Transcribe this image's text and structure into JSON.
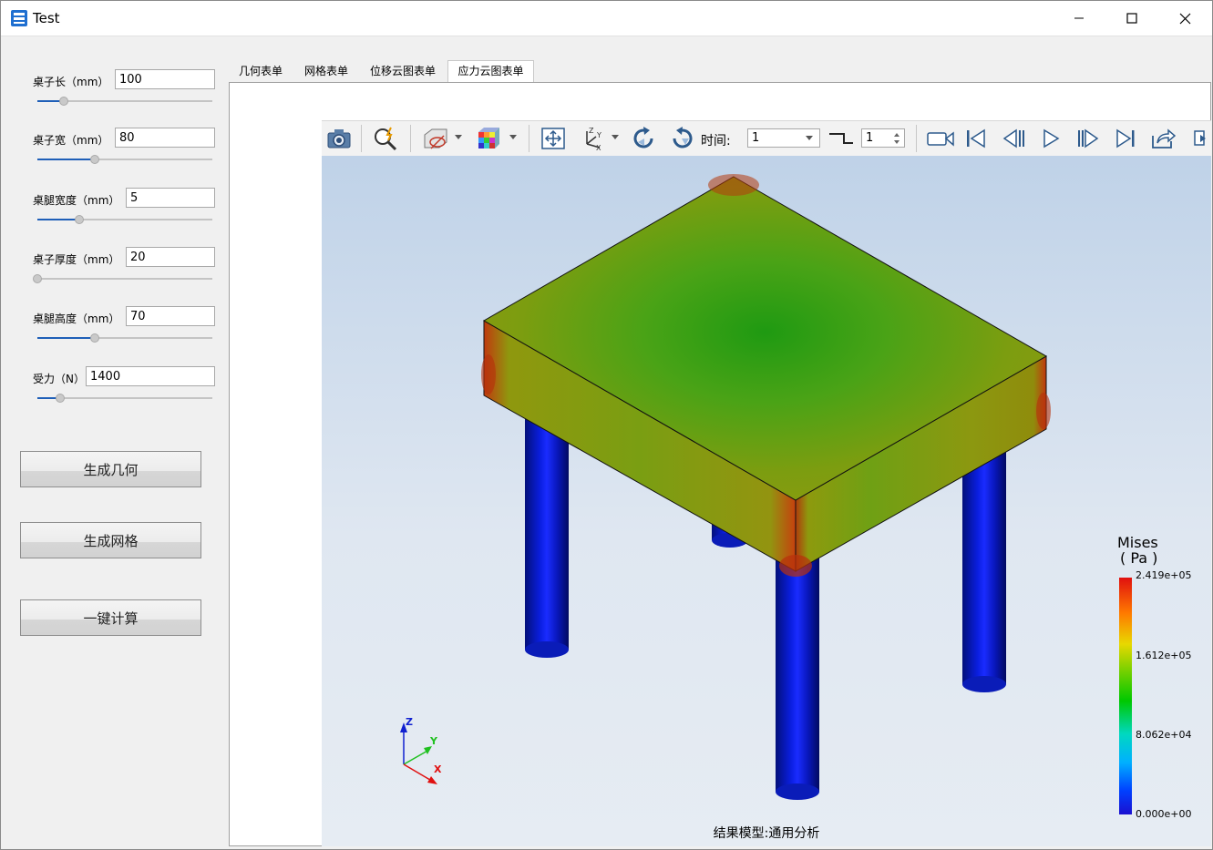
{
  "window": {
    "title": "Test"
  },
  "params": [
    {
      "label": "桌子长（mm）",
      "value": "100",
      "slider": 0.15
    },
    {
      "label": "桌子宽（mm）",
      "value": "80",
      "slider": 0.33
    },
    {
      "label": "桌腿宽度（mm）",
      "value": "5",
      "slider": 0.24
    },
    {
      "label": "桌子厚度（mm）",
      "value": "20",
      "slider": 0.0
    },
    {
      "label": "桌腿高度（mm）",
      "value": "70",
      "slider": 0.33
    },
    {
      "label": "受力（N）",
      "value": "1400",
      "slider": 0.13
    }
  ],
  "buttons": {
    "gen_geometry": "生成几何",
    "gen_mesh": "生成网格",
    "one_click_calc": "一键计算"
  },
  "tabs": [
    {
      "label": "几何表单",
      "active": false
    },
    {
      "label": "网格表单",
      "active": false
    },
    {
      "label": "位移云图表单",
      "active": false
    },
    {
      "label": "应力云图表单",
      "active": true
    }
  ],
  "toolbar": {
    "time_label": "时间:",
    "time_value": "1",
    "step_value": "1",
    "icons": [
      "camera-icon",
      "zoom-icon",
      "visibility-icon",
      "color-map-icon",
      "fit-view-icon",
      "axis-icon",
      "rotate-cw-icon",
      "rotate-ccw-icon",
      "record-icon",
      "first-frame-icon",
      "prev-frame-icon",
      "play-icon",
      "next-frame-icon",
      "last-frame-icon",
      "export-icon"
    ]
  },
  "legend": {
    "title": "Mises",
    "unit": "( Pa )",
    "ticks": [
      "2.419e+05",
      "1.612e+05",
      "8.062e+04",
      "0.000e+00"
    ]
  },
  "triad": {
    "z": "Z",
    "y": "Y",
    "x": "X"
  },
  "status": "结果模型:通用分析",
  "colors": {
    "accent": "#1f5fb8",
    "leg": "#0a14c8",
    "stress_high": "#c62a10",
    "stress_mid": "#20a020"
  }
}
